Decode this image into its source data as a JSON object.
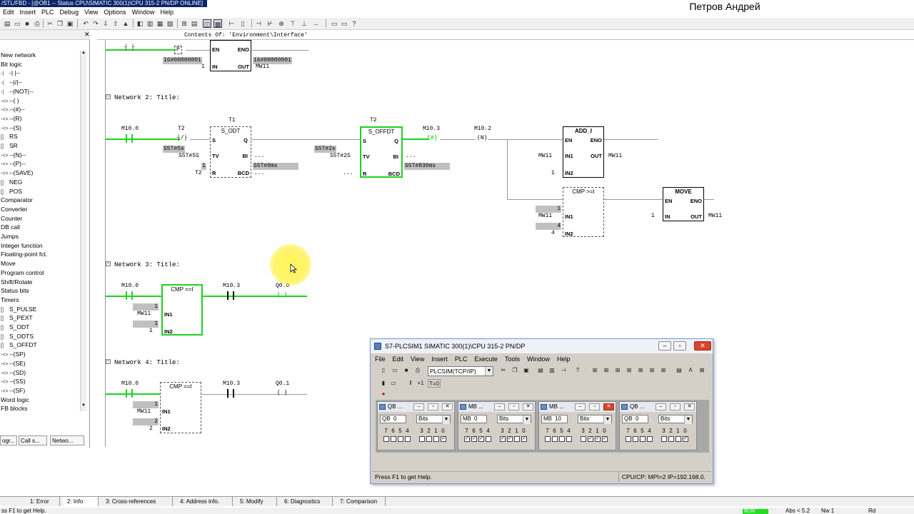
{
  "window": {
    "title": "/STL/FBD - [@OB1 -- Status CPU\\SIMATIC 300(1)\\CPU 315-2 PN/DP  ONLINE]",
    "user_name": "Петров Андрей"
  },
  "menu": [
    "Edit",
    "Insert",
    "PLC",
    "Debug",
    "View",
    "Options",
    "Window",
    "Help"
  ],
  "editor": {
    "header": "Contents Of: 'Environment\\Interface'"
  },
  "catalog": {
    "items": [
      {
        "icon": "",
        "label": "New network"
      },
      {
        "icon": "",
        "label": "Bit logic"
      },
      {
        "icon": "-|",
        "label": "-| |--"
      },
      {
        "icon": "-|",
        "label": "--|/|--"
      },
      {
        "icon": "-|",
        "label": "--|NOT|--"
      },
      {
        "icon": "-<>",
        "label": "--( )"
      },
      {
        "icon": "-<>",
        "label": "--(#)--"
      },
      {
        "icon": "-<>",
        "label": "--(R)"
      },
      {
        "icon": "-<>",
        "label": "--(S)"
      },
      {
        "icon": "[]",
        "label": "RS"
      },
      {
        "icon": "[]",
        "label": "SR"
      },
      {
        "icon": "-<>",
        "label": "--(N)--"
      },
      {
        "icon": "-<>",
        "label": "--(P)--"
      },
      {
        "icon": "-<>",
        "label": "--(SAVE)"
      },
      {
        "icon": "[]",
        "label": "NEG"
      },
      {
        "icon": "[]",
        "label": "POS"
      },
      {
        "icon": "",
        "label": "Comparator"
      },
      {
        "icon": "",
        "label": "Converter"
      },
      {
        "icon": "",
        "label": "Counter"
      },
      {
        "icon": "",
        "label": "DB call"
      },
      {
        "icon": "",
        "label": "Jumps"
      },
      {
        "icon": "",
        "label": "Integer function"
      },
      {
        "icon": "",
        "label": "Floating-point fct."
      },
      {
        "icon": "",
        "label": "Move"
      },
      {
        "icon": "",
        "label": "Program control"
      },
      {
        "icon": "",
        "label": "Shift/Rotate"
      },
      {
        "icon": "",
        "label": "Status bits"
      },
      {
        "icon": "",
        "label": "Timers"
      },
      {
        "icon": "[]",
        "label": "S_PULSE"
      },
      {
        "icon": "[]",
        "label": "S_PEXT"
      },
      {
        "icon": "[]",
        "label": "S_ODT"
      },
      {
        "icon": "[]",
        "label": "S_ODTS"
      },
      {
        "icon": "[]",
        "label": "S_OFFDT"
      },
      {
        "icon": "-<>",
        "label": "--(SP)"
      },
      {
        "icon": "-<>",
        "label": "--(SE)"
      },
      {
        "icon": "-<>",
        "label": "--(SD)"
      },
      {
        "icon": "-<>",
        "label": "--(SS)"
      },
      {
        "icon": "-<>",
        "label": "--(SF)"
      },
      {
        "icon": "",
        "label": "Word logic"
      },
      {
        "icon": "",
        "label": "FB blocks"
      }
    ],
    "tabs": [
      "ogr...",
      "Call s...",
      "Netwo..."
    ]
  },
  "network1": {
    "edge": "P",
    "move_title": "MOVE",
    "en": "EN",
    "eno": "ENO",
    "in": "IN",
    "out": "OUT",
    "in_val": "16#00000001",
    "out_val": "16#00000001",
    "in_const": "1",
    "out_op": "MW11"
  },
  "network2": {
    "label": "Network 2",
    "title_suffix": ": Title:",
    "c1": "M10.0",
    "c2": "T2",
    "t1_name": "T1",
    "t1_type": "S_ODT",
    "t1_tv_val": "S5T#5s",
    "t1_tv": "S5T#5S",
    "t1_r_val": "1",
    "t1_r": "T2",
    "t1_bcd_val": "S5T#0ms",
    "t2_name": "T2",
    "t2_type": "S_OFFDT",
    "t2_tv_val": "S5T#2s",
    "t2_tv": "S5T#2S",
    "t2_bcd_val": "S5T#830ms",
    "coil": "M10.3",
    "coil_sym": "#",
    "edge_op": "M10.2",
    "edge_sym": "N",
    "add_title": "ADD_I",
    "add_in1": "MW11",
    "add_in2": "1",
    "add_out": "MW11",
    "cmp_title": "CMP >=I",
    "cmp_in1_val": "1",
    "cmp_in1": "MW11",
    "cmp_in2_val": "4",
    "cmp_in2": "4",
    "move_title": "MOVE",
    "move_in": "1",
    "move_out": "MW11",
    "pins": {
      "s": "S",
      "q": "Q",
      "tv": "TV",
      "bi": "BI",
      "r": "R",
      "bcd": "BCD",
      "en": "EN",
      "eno": "ENO",
      "in1": "IN1",
      "in2": "IN2",
      "out": "OUT",
      "in": "IN"
    },
    "dots": "..."
  },
  "network3": {
    "label": "Network 3",
    "title_suffix": ": Title:",
    "c1": "M10.0",
    "cmp_title": "CMP ==I",
    "in1_val": "1",
    "in1": "MW11",
    "in2_val": "1",
    "in2": "1",
    "c2": "M10.3",
    "coil": "Q0.0"
  },
  "network4": {
    "label": "Network 4",
    "title_suffix": ": Title:",
    "c1": "M10.0",
    "cmp_title": "CMP ==I",
    "in1_val": "1",
    "in1": "MW11",
    "in2_val": "2",
    "in2": "2",
    "c2": "M10.3",
    "coil": "Q0.1"
  },
  "plcsim": {
    "title": "S7-PLCSIM1    SIMATIC 300(1)\\CPU 315-2 PN/DP",
    "menu": [
      "File",
      "Edit",
      "View",
      "Insert",
      "PLC",
      "Execute",
      "Tools",
      "Window",
      "Help"
    ],
    "combo": "PLCSIM(TCP/IP)",
    "t0_label": "T=0",
    "status_left": "Press F1 to get Help.",
    "status_right": "CPU/CP:  MPI=2 IP=192.168.0.",
    "subwindows": [
      {
        "title": "QB ...",
        "type": "QB",
        "addr": "0",
        "fmt": "Bits",
        "checked": [
          0
        ]
      },
      {
        "title": "MB ...",
        "type": "MB",
        "addr": "0",
        "fmt": "Bits",
        "checked": [
          0,
          2,
          3,
          5,
          6,
          7
        ]
      },
      {
        "title": "MB ...",
        "type": "MB",
        "addr": "10",
        "fmt": "Bits",
        "checked": [
          0,
          1,
          2
        ]
      },
      {
        "title": "QB ...",
        "type": "QB",
        "addr": "0",
        "fmt": "Bits",
        "checked": [
          0
        ]
      }
    ],
    "bit_labels": [
      "7",
      "6",
      "5",
      "4",
      "3",
      "2",
      "1",
      "0"
    ]
  },
  "bottom_tabs": [
    "1: Error",
    "2: Info",
    "3: Cross-references",
    "4: Address info.",
    "5: Modify",
    "6: Diagnostics",
    "7: Comparison"
  ],
  "statusbar": {
    "left": "ss F1 to get Help.",
    "run": "RUN",
    "abs": "Abs < 5.2",
    "nw": "Nw 1",
    "rd": "Rd"
  }
}
